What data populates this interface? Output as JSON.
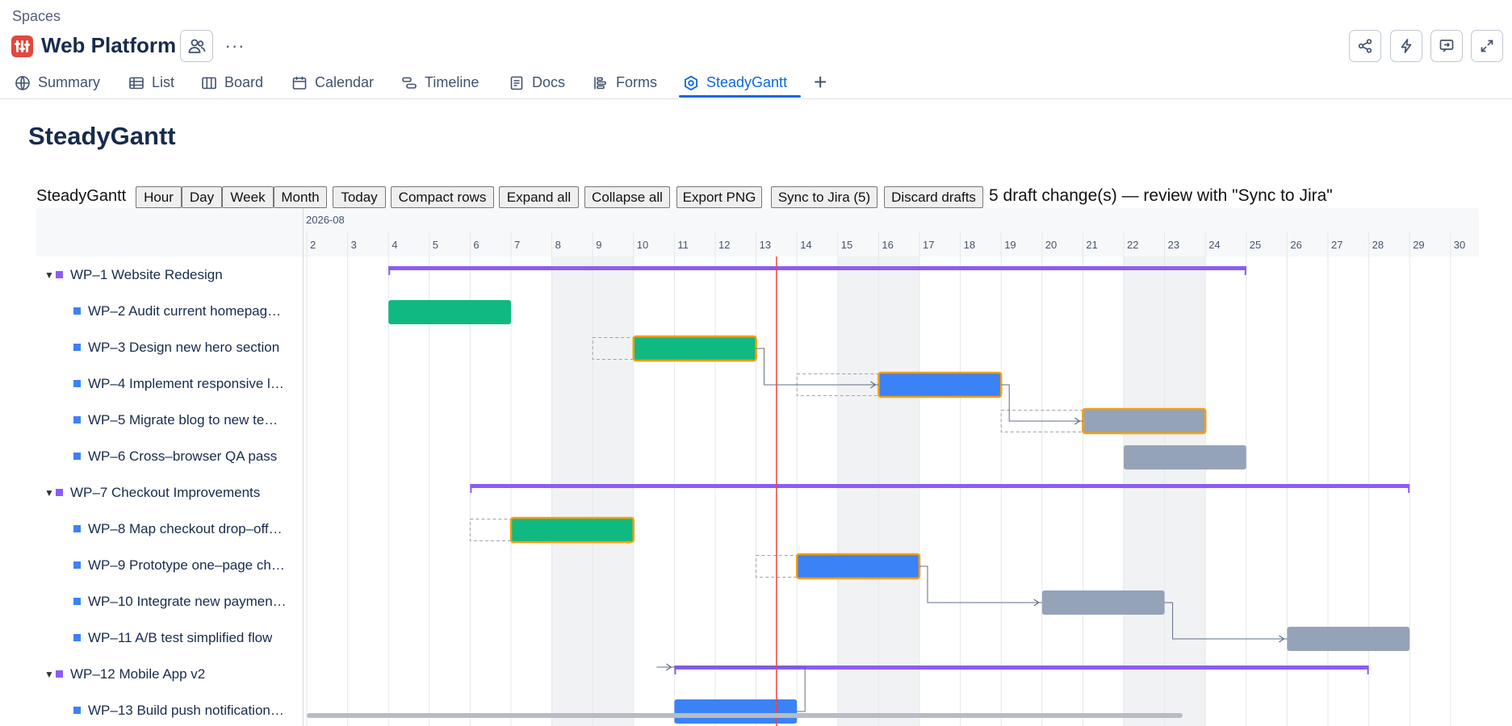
{
  "header": {
    "breadcrumb": "Spaces",
    "project_title": "Web Platform",
    "more_label": "···"
  },
  "tabs": [
    {
      "label": "Summary",
      "icon": "globe-icon"
    },
    {
      "label": "List",
      "icon": "list-icon"
    },
    {
      "label": "Board",
      "icon": "board-icon"
    },
    {
      "label": "Calendar",
      "icon": "calendar-icon"
    },
    {
      "label": "Timeline",
      "icon": "timeline-icon"
    },
    {
      "label": "Docs",
      "icon": "docs-icon"
    },
    {
      "label": "Forms",
      "icon": "forms-icon"
    },
    {
      "label": "SteadyGantt",
      "icon": "steadygantt-icon",
      "active": true
    }
  ],
  "page": {
    "title": "SteadyGantt"
  },
  "toolbar": {
    "label": "SteadyGantt",
    "buttons": [
      "Hour",
      "Day",
      "Week",
      "Month",
      "Today",
      "Compact rows",
      "Expand all",
      "Collapse all",
      "Export PNG",
      "Sync to Jira (5)",
      "Discard drafts"
    ],
    "draft_message": "5 draft change(s) — review with \"Sync to Jira\""
  },
  "gantt": {
    "month_label": "2026-08",
    "days": [
      "2",
      "3",
      "4",
      "5",
      "6",
      "7",
      "8",
      "9",
      "10",
      "11",
      "12",
      "13",
      "14",
      "15",
      "16",
      "17",
      "18",
      "19",
      "20",
      "21",
      "22",
      "23",
      "24",
      "25",
      "26",
      "27",
      "28",
      "29",
      "30"
    ],
    "weekend_days": [
      "8",
      "9",
      "15",
      "16",
      "22",
      "23"
    ],
    "today": 13.5,
    "rows": [
      {
        "key": "WP-1",
        "title": "Website Redesign",
        "display": "WP–1  Website Redesign",
        "parent": true,
        "start": 4,
        "end": 25
      },
      {
        "key": "WP-2",
        "title": "Audit current homepage",
        "display": "WP–2  Audit current homepag…",
        "start": 4,
        "end": 7,
        "status": "done"
      },
      {
        "key": "WP-3",
        "title": "Design new hero section",
        "display": "WP–3  Design new hero section",
        "start": 10,
        "end": 13,
        "status": "done",
        "draft": true,
        "orig_start": 9,
        "orig_end": 12
      },
      {
        "key": "WP-4",
        "title": "Implement responsive layout",
        "display": "WP–4  Implement responsive l…",
        "start": 16,
        "end": 19,
        "status": "inprogress",
        "draft": true,
        "orig_start": 14,
        "orig_end": 17
      },
      {
        "key": "WP-5",
        "title": "Migrate blog to new template",
        "display": "WP–5  Migrate blog to new te…",
        "start": 21,
        "end": 24,
        "status": "todo",
        "draft": true,
        "orig_start": 19,
        "orig_end": 22
      },
      {
        "key": "WP-6",
        "title": "Cross-browser QA pass",
        "display": "WP–6  Cross–browser QA pass",
        "start": 22,
        "end": 25,
        "status": "todo"
      },
      {
        "key": "WP-7",
        "title": "Checkout Improvements",
        "display": "WP–7  Checkout Improvements",
        "parent": true,
        "start": 6,
        "end": 29
      },
      {
        "key": "WP-8",
        "title": "Map checkout drop-off points",
        "display": "WP–8  Map checkout drop–off…",
        "start": 7,
        "end": 10,
        "status": "done",
        "draft": true,
        "orig_start": 6,
        "orig_end": 9
      },
      {
        "key": "WP-9",
        "title": "Prototype one-page checkout",
        "display": "WP–9  Prototype one–page ch…",
        "start": 14,
        "end": 17,
        "status": "inprogress",
        "draft": true,
        "orig_start": 13,
        "orig_end": 16
      },
      {
        "key": "WP-10",
        "title": "Integrate new payment provider",
        "display": "WP–10  Integrate new paymen…",
        "start": 20,
        "end": 23,
        "status": "todo"
      },
      {
        "key": "WP-11",
        "title": "A/B test simplified flow",
        "display": "WP–11  A/B test simplified flow",
        "start": 26,
        "end": 29,
        "status": "todo"
      },
      {
        "key": "WP-12",
        "title": "Mobile App v2",
        "display": "WP–12  Mobile App v2",
        "parent": true,
        "start": 11,
        "end": 28
      },
      {
        "key": "WP-13",
        "title": "Build push notifications",
        "display": "WP–13  Build push notification…",
        "start": 11,
        "end": 14,
        "status": "inprogress"
      }
    ],
    "dependencies": [
      {
        "from": "WP-3",
        "to": "WP-4"
      },
      {
        "from": "WP-4",
        "to": "WP-5"
      },
      {
        "from": "WP-9",
        "to": "WP-10"
      },
      {
        "from": "WP-10",
        "to": "WP-11"
      },
      {
        "from": "WP-13",
        "to": "WP-12"
      }
    ],
    "colors": {
      "done": "#10b981",
      "inprogress": "#3b82f6",
      "todo": "#94a3b8",
      "parent": "#8b5cf6",
      "draft_border": "#f59e0b",
      "today_line": "#ef4444",
      "grid_line": "#e5e7eb",
      "weekend": "#f1f2f4"
    }
  }
}
